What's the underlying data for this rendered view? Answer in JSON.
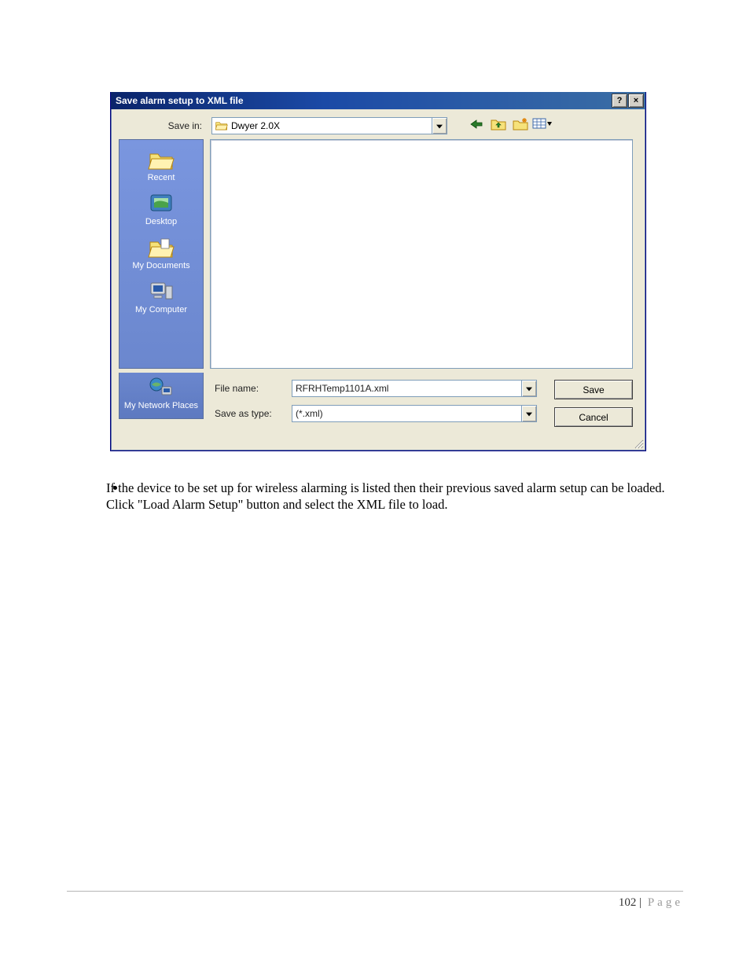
{
  "dialog": {
    "title": "Save alarm setup to XML file",
    "help_glyph": "?",
    "close_glyph": "×",
    "save_in_label": "Save in:",
    "save_in_value": "Dwyer 2.0X",
    "toolbar": {
      "back": "back-icon",
      "up": "up-one-level-icon",
      "newfolder": "new-folder-icon",
      "views": "views-icon"
    },
    "places": [
      {
        "id": "recent",
        "label": "Recent"
      },
      {
        "id": "desktop",
        "label": "Desktop"
      },
      {
        "id": "documents",
        "label": "My Documents"
      },
      {
        "id": "computer",
        "label": "My Computer"
      },
      {
        "id": "network",
        "label": "My Network Places"
      }
    ],
    "filename_label": "File name:",
    "filename_value": "RFRHTemp1101A.xml",
    "saveastype_label": "Save as type:",
    "saveastype_value": "(*.xml)",
    "save_button": "Save",
    "cancel_button": "Cancel"
  },
  "body_text": {
    "bullet": "If the device to be set up for wireless alarming is listed then their previous saved alarm setup can be loaded. Click \"Load Alarm Setup\" button and select the XML file to load."
  },
  "footer": {
    "page_number": "102",
    "sep": " | ",
    "page_label": "Page"
  }
}
